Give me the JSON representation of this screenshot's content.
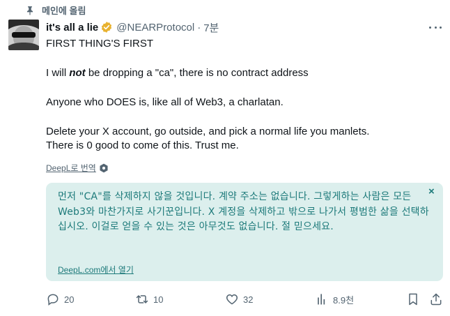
{
  "pinned": {
    "label": "메인에 올림",
    "icon": "pin-icon"
  },
  "author": {
    "display_name": "it's all a lie",
    "verified_icon": "verified-badge-icon",
    "verified_color": "#e8b230",
    "handle": "@NEARProtocol",
    "separator": "·",
    "time": "7분"
  },
  "post": {
    "line1": "FIRST THING'S FIRST",
    "line2_pre": "I will ",
    "line2_emph": "not",
    "line2_post": " be dropping a \"ca\", there is no contract address",
    "line3": "Anyone who DOES is, like all of Web3, a charlatan.",
    "line4": "Delete your X account, go outside, and pick a normal life you manlets.",
    "line5": "There is 0 good to come of this. Trust me."
  },
  "translate": {
    "label": "DeepL로 번역",
    "icon": "settings-icon"
  },
  "translation": {
    "text": "먼저 \"CA\"를 삭제하지 않을 것입니다. 계약 주소는 없습니다. 그렇게하는 사람은 모든 Web3와 마찬가지로 사기꾼입니다. X 계정을 삭제하고 밖으로 나가서 평범한 삶을 선택하십시오. 이걸로 얻을 수 있는 것은 아무것도 없습니다. 절 믿으세요.",
    "close": "×",
    "link": "DeepL.com에서 열기",
    "color": "#1d7a7a",
    "bg": "#dcefed"
  },
  "actions": {
    "reply_count": "20",
    "repost_count": "10",
    "like_count": "32",
    "views_count": "8.9천"
  },
  "colors": {
    "text": "#0f1419",
    "muted": "#536471"
  }
}
